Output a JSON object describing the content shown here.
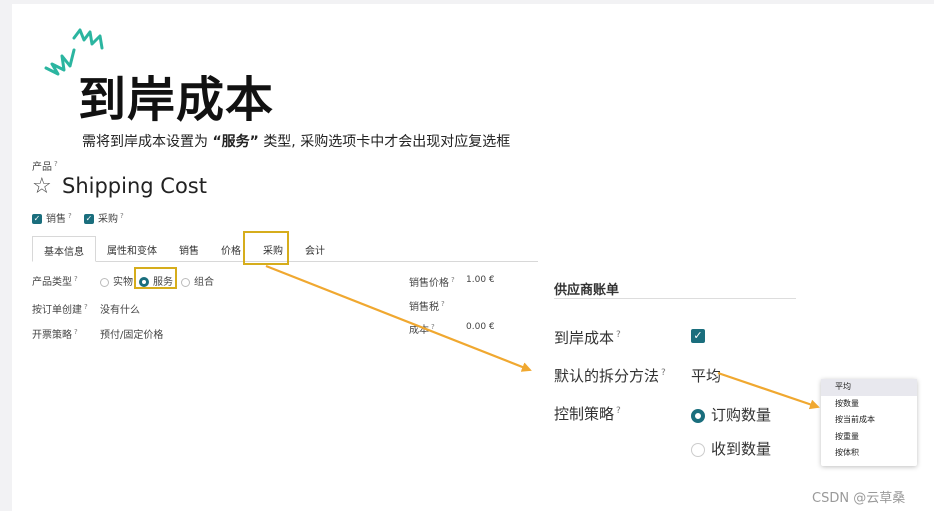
{
  "slide": {
    "title": "到岸成本",
    "subtitle_prefix": "需将到岸成本设置为",
    "subtitle_bold": "“服务”",
    "subtitle_suffix": "类型, 采购选项卡中才会出现对应复选框"
  },
  "product": {
    "field_label": "产品",
    "name": "Shipping Cost",
    "checkbox_sales": "销售",
    "checkbox_purchase": "采购",
    "tabs": [
      "基本信息",
      "属性和变体",
      "销售",
      "价格",
      "采购",
      "会计"
    ],
    "active_tab": "基本信息",
    "product_type_label": "产品类型",
    "type_options": [
      "实物",
      "服务",
      "组合"
    ],
    "type_selected": "服务",
    "order_create_label": "按订单创建",
    "order_create_value": "没有什么",
    "invoice_policy_label": "开票策略",
    "invoice_policy_value": "预付/固定价格",
    "sales_price_label": "销售价格",
    "sales_price_value": "1.00 €",
    "sales_tax_label": "销售税",
    "cost_label": "成本",
    "cost_value": "0.00 €"
  },
  "vendor_bill": {
    "section_title": "供应商账单",
    "landed_cost_label": "到岸成本",
    "split_method_label": "默认的拆分方法",
    "split_method_value": "平均",
    "control_policy_label": "控制策略",
    "control_options": [
      "订购数量",
      "收到数量"
    ],
    "control_selected": "订购数量"
  },
  "split_dropdown": {
    "options": [
      "平均",
      "按数量",
      "按当前成本",
      "按重量",
      "按体积"
    ],
    "selected": "平均"
  },
  "watermark": "CSDN @云草桑",
  "colors": {
    "accent_teal": "#1a6e7d",
    "highlight": "#d6ad1c",
    "arrow": "#f0a830",
    "sparkle": "#2bb5a0"
  }
}
